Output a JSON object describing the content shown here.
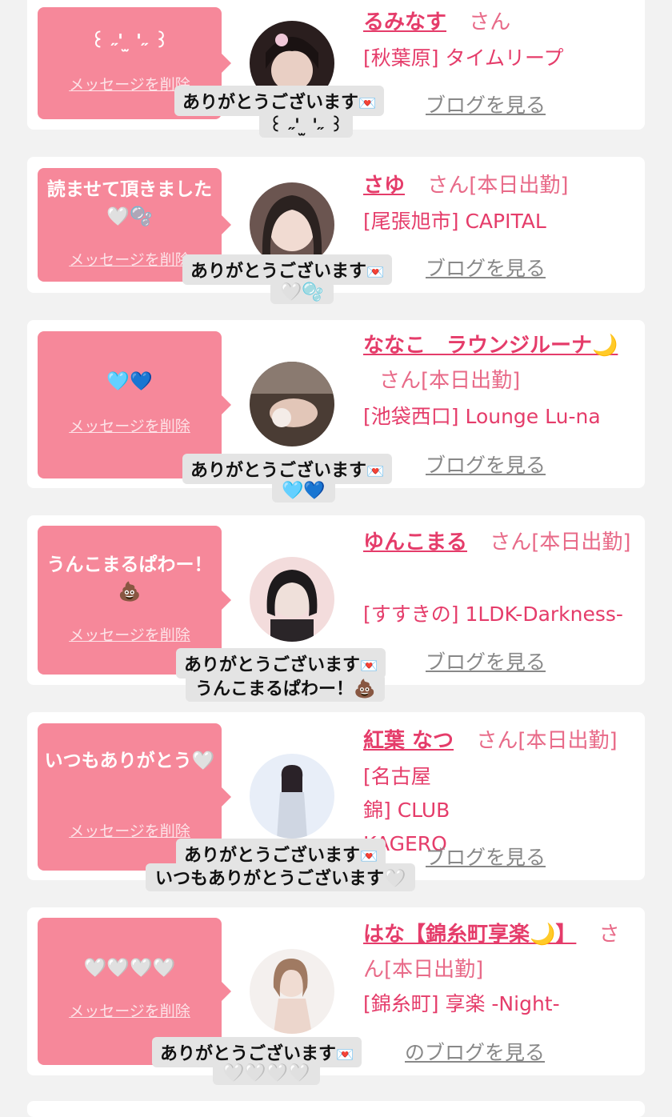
{
  "delete_label": "メッセージを削除",
  "blog_label": "ブログを見る",
  "blog_label_full": "のブログを見る",
  "san_label": "さん",
  "thanks_label": "ありがとうございます",
  "mail_icon": "💌",
  "colors": {
    "bubble": "#f6889a",
    "name": "#e53c6a",
    "background": "#f2f2f2"
  },
  "cards": [
    {
      "message": "꒰ ˶'  ̫ '˶ ꒱",
      "name": "るみなす",
      "san": "さん",
      "shop": "[秋葉原] タイムリープ",
      "reply": "꒰ ˶'  ̫ '˶ ꒱"
    },
    {
      "message": "読ませて頂きました🤍🫧",
      "name": "さゆ",
      "san": "さん[本日出勤]",
      "shop": "[尾張旭市] CAPITAL",
      "reply": "🤍🫧"
    },
    {
      "message": "🩵💙",
      "name": "ななこ　ラウンジルーナ🌙",
      "san": "さん[本日出勤]",
      "shop": "[池袋西口] Lounge Lu-na",
      "reply": "🩵💙"
    },
    {
      "message": "うんこまるぱわー！💩",
      "name": "ゆんこまる",
      "san": "さん[本日出勤]",
      "shop": "[すすきの] 1LDK-Darkness-",
      "reply": "うんこまるぱわー！💩"
    },
    {
      "message": "いつもありがとう🤍",
      "name": "紅葉 なつ",
      "san": "さん[本日出勤]",
      "shop": "[名古屋 錦] CLUB KAGERO",
      "reply": "いつもありがとうございます🤍"
    },
    {
      "message": "🤍🤍🤍🤍",
      "name": "はな【錦糸町享楽🌙】",
      "san": "さん[本日出勤]",
      "shop": "[錦糸町] 享楽 -Night-",
      "reply": "🤍🤍🤍🤍"
    }
  ]
}
